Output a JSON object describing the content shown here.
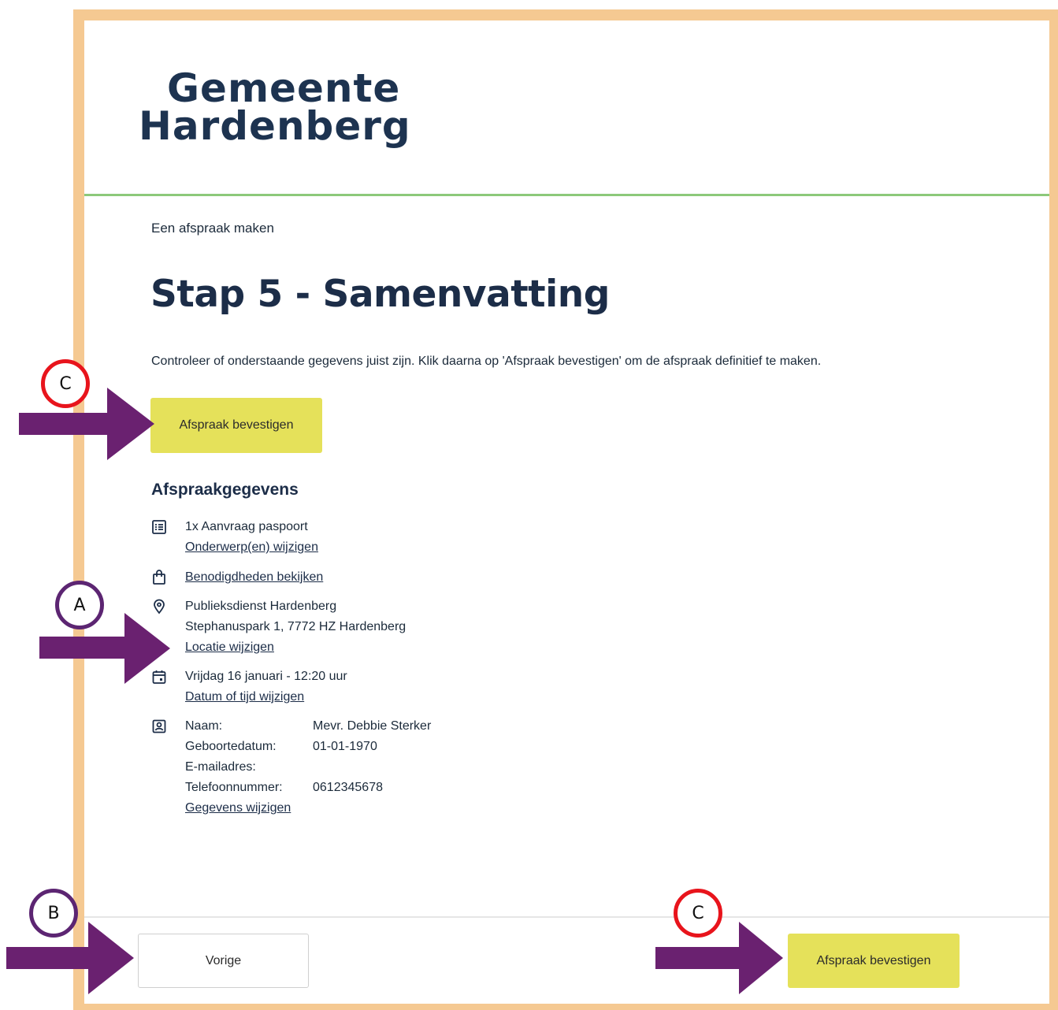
{
  "logo": {
    "line1": "Gemeente",
    "line2": "Hardenberg"
  },
  "breadcrumb": "Een afspraak maken",
  "title": "Stap 5 - Samenvatting",
  "intro": "Controleer of onderstaande gegevens juist zijn. Klik daarna op 'Afspraak bevestigen' om de afspraak definitief te maken.",
  "confirm_label": "Afspraak bevestigen",
  "section_title": "Afspraakgegevens",
  "details": {
    "subject": {
      "text": "1x Aanvraag paspoort",
      "link": "Onderwerp(en) wijzigen",
      "icon": "list-icon"
    },
    "requirements": {
      "link": "Benodigdheden bekijken",
      "icon": "shopping-bag-icon"
    },
    "location": {
      "name": "Publieksdienst Hardenberg",
      "address": "Stephanuspark 1, 7772 HZ Hardenberg",
      "link": "Locatie wijzigen",
      "icon": "location-pin-icon"
    },
    "datetime": {
      "text": "Vrijdag 16 januari - 12:20 uur",
      "link": "Datum of tijd wijzigen",
      "icon": "calendar-icon"
    },
    "person": {
      "icon": "contact-card-icon",
      "fields": [
        {
          "label": "Naam:",
          "value": "Mevr. Debbie Sterker"
        },
        {
          "label": "Geboortedatum:",
          "value": "01-01-1970"
        },
        {
          "label": "E-mailadres:",
          "value": ""
        },
        {
          "label": "Telefoonnummer:",
          "value": "0612345678"
        }
      ],
      "link": "Gegevens wijzigen"
    }
  },
  "footer": {
    "prev_label": "Vorige",
    "confirm_label": "Afspraak bevestigen"
  },
  "annotations": {
    "marker_c": "C",
    "marker_a": "A",
    "marker_b": "B",
    "colors": {
      "arrow": "#6a2170",
      "marker_red": "#e8141c",
      "marker_purple": "#5c2572",
      "frame": "#f5c992",
      "button": "#e5e15a"
    }
  }
}
